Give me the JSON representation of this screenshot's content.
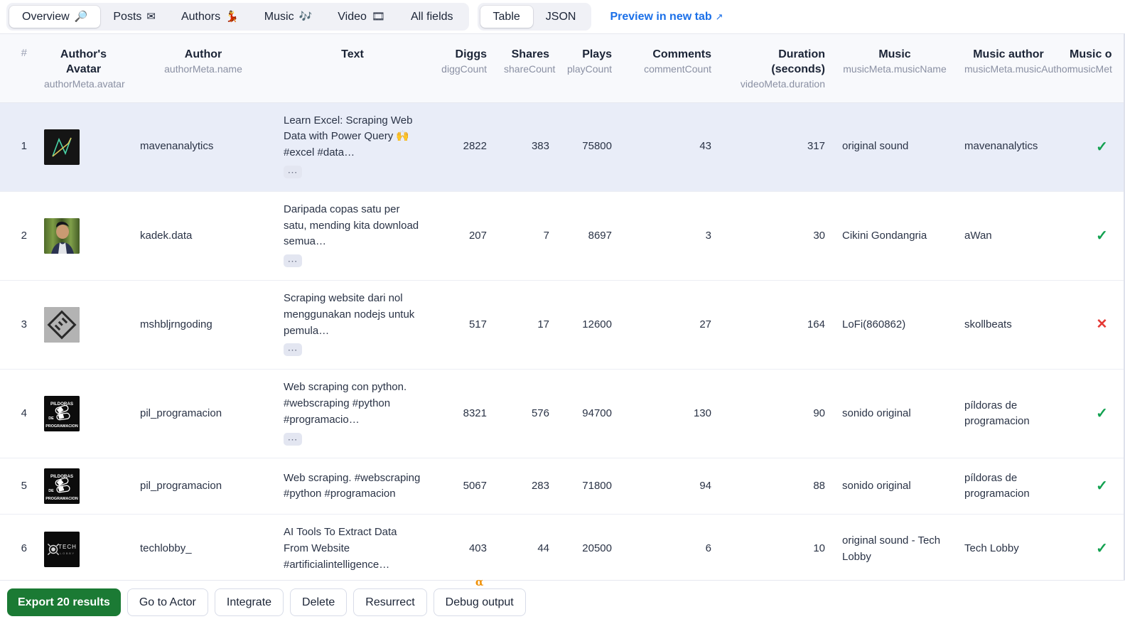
{
  "toolbar": {
    "field_tabs": [
      {
        "label": "Overview",
        "icon": "🔎",
        "icon_name": "magnifier-icon",
        "active": true
      },
      {
        "label": "Posts",
        "icon": "✉",
        "icon_name": "envelope-icon",
        "active": false
      },
      {
        "label": "Authors",
        "icon": "💃",
        "icon_name": "dancer-icon",
        "active": false
      },
      {
        "label": "Music",
        "icon": "🎶",
        "icon_name": "music-notes-icon",
        "active": false
      },
      {
        "label": "Video",
        "icon": "🎞",
        "icon_name": "film-strip-icon",
        "active": false
      },
      {
        "label": "All fields",
        "icon": "",
        "icon_name": "",
        "active": false
      }
    ],
    "view_tabs": [
      {
        "label": "Table",
        "active": true
      },
      {
        "label": "JSON",
        "active": false
      }
    ],
    "preview_link": {
      "label": "Preview in new tab",
      "arrow": "↗"
    }
  },
  "table": {
    "columns": [
      {
        "title": "#",
        "sub": "",
        "align": "right"
      },
      {
        "title": "Author's Avatar",
        "sub": "authorMeta.avatar",
        "align": "left"
      },
      {
        "title": "Author",
        "sub": "authorMeta.name",
        "align": "left"
      },
      {
        "title": "Text",
        "sub": "",
        "align": "left"
      },
      {
        "title": "Diggs",
        "sub": "diggCount",
        "align": "right"
      },
      {
        "title": "Shares",
        "sub": "shareCount",
        "align": "right"
      },
      {
        "title": "Plays",
        "sub": "playCount",
        "align": "right"
      },
      {
        "title": "Comments",
        "sub": "commentCount",
        "align": "right"
      },
      {
        "title": "Duration (seconds)",
        "sub": "videoMeta.duration",
        "align": "right"
      },
      {
        "title": "Music",
        "sub": "musicMeta.musicName",
        "align": "left"
      },
      {
        "title": "Music author",
        "sub": "musicMeta.musicAuthor",
        "align": "left"
      },
      {
        "title": "Music o",
        "sub": "musicMet",
        "align": "left"
      }
    ],
    "rows": [
      {
        "index": "1",
        "avatar_name": "mavenanalytics-avatar",
        "author": "mavenanalytics",
        "text": "Learn Excel: Scraping Web Data with Power Query 🙌 #excel #data…",
        "has_more": true,
        "diggs": "2822",
        "shares": "383",
        "plays": "75800",
        "comments": "43",
        "duration": "317",
        "music": "original sound",
        "music_author": "mavenanalytics",
        "music_original": "check",
        "selected": true
      },
      {
        "index": "2",
        "avatar_name": "kadek-data-avatar",
        "author": "kadek.data",
        "text": "Daripada copas satu per satu, mending kita download semua…",
        "has_more": true,
        "diggs": "207",
        "shares": "7",
        "plays": "8697",
        "comments": "3",
        "duration": "30",
        "music": "Cikini Gondangria",
        "music_author": "aWan",
        "music_original": "check",
        "selected": false
      },
      {
        "index": "3",
        "avatar_name": "mshbljrngoding-avatar",
        "author": "mshbljrngoding",
        "text": "Scraping website dari nol menggunakan nodejs untuk pemula…",
        "has_more": true,
        "diggs": "517",
        "shares": "17",
        "plays": "12600",
        "comments": "27",
        "duration": "164",
        "music": "LoFi(860862)",
        "music_author": "skollbeats",
        "music_original": "cross",
        "selected": false
      },
      {
        "index": "4",
        "avatar_name": "pil-programacion-avatar",
        "author": "pil_programacion",
        "text": "Web scraping con python. #webscraping #python #programacio…",
        "has_more": true,
        "diggs": "8321",
        "shares": "576",
        "plays": "94700",
        "comments": "130",
        "duration": "90",
        "music": "sonido original",
        "music_author": "píldoras de programacion",
        "music_original": "check",
        "selected": false
      },
      {
        "index": "5",
        "avatar_name": "pil-programacion-avatar",
        "author": "pil_programacion",
        "text": "Web scraping. #webscraping #python #programacion",
        "has_more": false,
        "diggs": "5067",
        "shares": "283",
        "plays": "71800",
        "comments": "94",
        "duration": "88",
        "music": "sonido original",
        "music_author": "píldoras de programacion",
        "music_original": "check",
        "selected": false
      },
      {
        "index": "6",
        "avatar_name": "techlobby-avatar",
        "author": "techlobby_",
        "text": "AI Tools To Extract Data From Website #artificialintelligence…",
        "has_more": false,
        "diggs": "403",
        "shares": "44",
        "plays": "20500",
        "comments": "6",
        "duration": "10",
        "music": "original sound - Tech Lobby",
        "music_author": "Tech Lobby",
        "music_original": "check",
        "selected": false
      }
    ]
  },
  "actions": {
    "export": {
      "label": "Export 20 results"
    },
    "goto": {
      "label": "Go to Actor"
    },
    "integrate": {
      "label": "Integrate"
    },
    "delete": {
      "label": "Delete"
    },
    "resurrect": {
      "label": "Resurrect"
    },
    "debug": {
      "label": "Debug output",
      "badge": "α"
    }
  },
  "colors": {
    "primary_green": "#1b7a34",
    "link_blue": "#1a6fe8",
    "selected_row": "#e9edf8",
    "check_green": "#12a150",
    "cross_red": "#e53935",
    "alpha_orange": "#f0920a"
  }
}
